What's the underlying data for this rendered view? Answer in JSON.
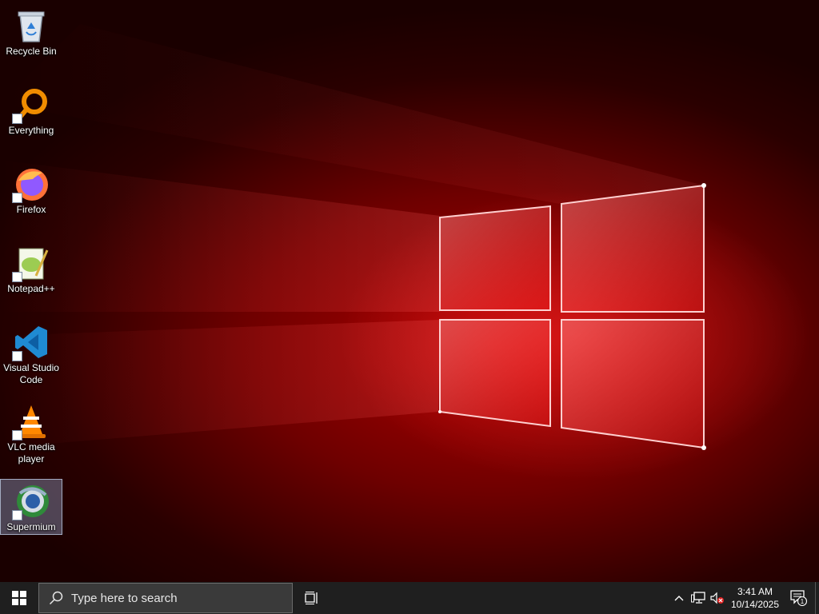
{
  "desktop": {
    "icons": [
      {
        "label": "Recycle Bin",
        "icon": "recycle-bin-icon",
        "shortcut": false
      },
      {
        "label": "Everything",
        "icon": "everything-search-icon",
        "shortcut": true
      },
      {
        "label": "Firefox",
        "icon": "firefox-icon",
        "shortcut": true
      },
      {
        "label": "Notepad++",
        "icon": "notepad-plus-plus-icon",
        "shortcut": true
      },
      {
        "label": "Visual Studio Code",
        "icon": "vscode-icon",
        "shortcut": true
      },
      {
        "label": "VLC media player",
        "icon": "vlc-icon",
        "shortcut": true
      },
      {
        "label": "Supermium",
        "icon": "supermium-icon",
        "shortcut": true,
        "selected": true
      }
    ]
  },
  "taskbar": {
    "search_placeholder": "Type here to search",
    "clock": {
      "time": "3:41 AM",
      "date": "10/14/2025"
    },
    "notification_count": "1"
  },
  "colors": {
    "taskbar_bg": "#1f1f1f",
    "wallpaper_red": "#b00000",
    "selection": "#a0b4dc"
  }
}
